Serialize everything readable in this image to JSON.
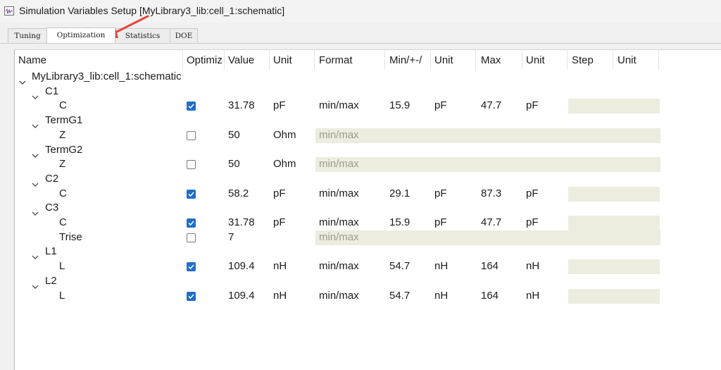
{
  "window": {
    "title": "Simulation Variables Setup [MyLibrary3_lib:cell_1:schematic]",
    "icon": "waveform-app-icon"
  },
  "tabs": [
    {
      "label": "Tuning",
      "active": false
    },
    {
      "label": "Optimization",
      "active": true
    },
    {
      "label": "Statistics",
      "active": false
    },
    {
      "label": "DOE",
      "active": false
    }
  ],
  "columns": [
    "Name",
    "Optimiz",
    "Value",
    "Unit",
    "Format",
    "Min/+-/",
    "Unit",
    "Max",
    "Unit",
    "Step",
    "Unit"
  ],
  "tree": {
    "root": "MyLibrary3_lib:cell_1:schematic",
    "rows": [
      {
        "kind": "group",
        "name": "C1"
      },
      {
        "kind": "param",
        "name": "C",
        "checked": true,
        "value": "31.78",
        "unit": "pF",
        "format": "min/max",
        "min": "15.9",
        "min_unit": "pF",
        "max": "47.7",
        "max_unit": "pF"
      },
      {
        "kind": "group",
        "name": "TermG1"
      },
      {
        "kind": "param",
        "name": "Z",
        "checked": false,
        "value": "50",
        "unit": "Ohm",
        "format": "min/max",
        "min": "",
        "min_unit": "",
        "max": "",
        "max_unit": ""
      },
      {
        "kind": "group",
        "name": "TermG2"
      },
      {
        "kind": "param",
        "name": "Z",
        "checked": false,
        "value": "50",
        "unit": "Ohm",
        "format": "min/max",
        "min": "",
        "min_unit": "",
        "max": "",
        "max_unit": ""
      },
      {
        "kind": "group",
        "name": "C2"
      },
      {
        "kind": "param",
        "name": "C",
        "checked": true,
        "value": "58.2",
        "unit": "pF",
        "format": "min/max",
        "min": "29.1",
        "min_unit": "pF",
        "max": "87.3",
        "max_unit": "pF"
      },
      {
        "kind": "group",
        "name": "C3"
      },
      {
        "kind": "param",
        "name": "C",
        "checked": true,
        "value": "31.78",
        "unit": "pF",
        "format": "min/max",
        "min": "15.9",
        "min_unit": "pF",
        "max": "47.7",
        "max_unit": "pF"
      },
      {
        "kind": "param",
        "name": "Trise",
        "checked": false,
        "value": "7",
        "unit": "",
        "format": "min/max",
        "min": "",
        "min_unit": "",
        "max": "",
        "max_unit": ""
      },
      {
        "kind": "group",
        "name": "L1"
      },
      {
        "kind": "param",
        "name": "L",
        "checked": true,
        "value": "109.4",
        "unit": "nH",
        "format": "min/max",
        "min": "54.7",
        "min_unit": "nH",
        "max": "164",
        "max_unit": "nH"
      },
      {
        "kind": "group",
        "name": "L2"
      },
      {
        "kind": "param",
        "name": "L",
        "checked": true,
        "value": "109.4",
        "unit": "nH",
        "format": "min/max",
        "min": "54.7",
        "min_unit": "nH",
        "max": "164",
        "max_unit": "nH"
      }
    ]
  },
  "colors": {
    "checkbox_checked": "#1f6fc7",
    "disabled_cell": "#ececdf",
    "annotation_arrow": "#e8453c"
  }
}
